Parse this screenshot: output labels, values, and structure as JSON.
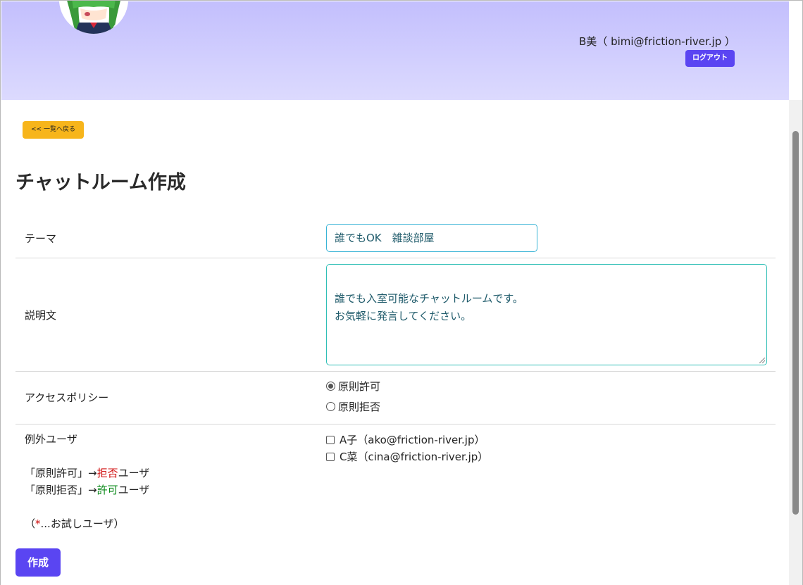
{
  "header": {
    "user_name": "B美",
    "user_email": "bimi@friction-river.jp",
    "logout_label": "ログアウト"
  },
  "back_label": "<< 一覧へ戻る",
  "page_title": "チャットルーム作成",
  "form": {
    "theme": {
      "label": "テーマ",
      "value": "誰でもOK　雑談部屋"
    },
    "description": {
      "label": "説明文",
      "value": "誰でも入室可能なチャットルームです。\nお気軽に発言してください。"
    },
    "access_policy": {
      "label": "アクセスポリシー",
      "options": [
        {
          "label": "原則許可",
          "checked": true
        },
        {
          "label": "原則拒否",
          "checked": false
        }
      ]
    },
    "exception_users": {
      "label": "例外ユーザ",
      "note1_prefix": "「原則許可」→",
      "note1_highlight": "拒否",
      "note1_suffix": "ユーザ",
      "note2_prefix": "「原則拒否」→",
      "note2_highlight": "許可",
      "note2_suffix": "ユーザ",
      "trial_open": "（",
      "trial_star": "*",
      "trial_text": "...お試しユーザ）",
      "users": [
        {
          "label": "A子（ako@friction-river.jp）",
          "checked": false
        },
        {
          "label": "C菜（cina@friction-river.jp）",
          "checked": false
        }
      ]
    }
  },
  "create_label": "作成",
  "colors": {
    "header_gradient_top": "#c3bffd",
    "header_gradient_bottom": "#dcdafe",
    "primary_button": "#5a45f2",
    "back_button": "#f7b51b",
    "deny_highlight": "#d01010",
    "allow_highlight": "#0b8a1a"
  }
}
